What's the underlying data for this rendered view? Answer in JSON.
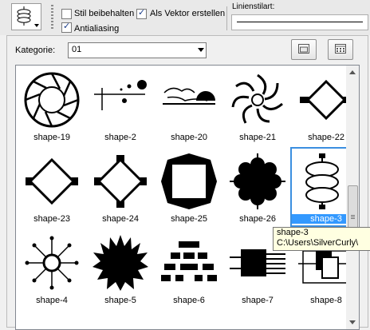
{
  "toolbar": {
    "keep_style_label": "Stil beibehalten",
    "keep_style_checked": false,
    "create_vector_label": "Als Vektor erstellen",
    "create_vector_checked": true,
    "antialiasing_label": "Antialiasing",
    "antialiasing_checked": true,
    "line_style_label": "Linienstilart:"
  },
  "dialog": {
    "category_label": "Kategorie:",
    "category_value": "01",
    "open_folder_icon": "folder-icon",
    "manage_icon": "grid-window-icon"
  },
  "gallery": {
    "selected": "shape-3",
    "items": [
      {
        "name": "shape-19"
      },
      {
        "name": "shape-2"
      },
      {
        "name": "shape-20"
      },
      {
        "name": "shape-21"
      },
      {
        "name": "shape-22"
      },
      {
        "name": "shape-23"
      },
      {
        "name": "shape-24"
      },
      {
        "name": "shape-25"
      },
      {
        "name": "shape-26"
      },
      {
        "name": "shape-3"
      },
      {
        "name": "shape-4"
      },
      {
        "name": "shape-5"
      },
      {
        "name": "shape-6"
      },
      {
        "name": "shape-7"
      },
      {
        "name": "shape-8"
      }
    ]
  },
  "tooltip": {
    "title": "shape-3",
    "path": "C:\\Users\\SilverCurly\\"
  },
  "colors": {
    "selection": "#3399ff",
    "tooltip_bg": "#ffffe1"
  }
}
